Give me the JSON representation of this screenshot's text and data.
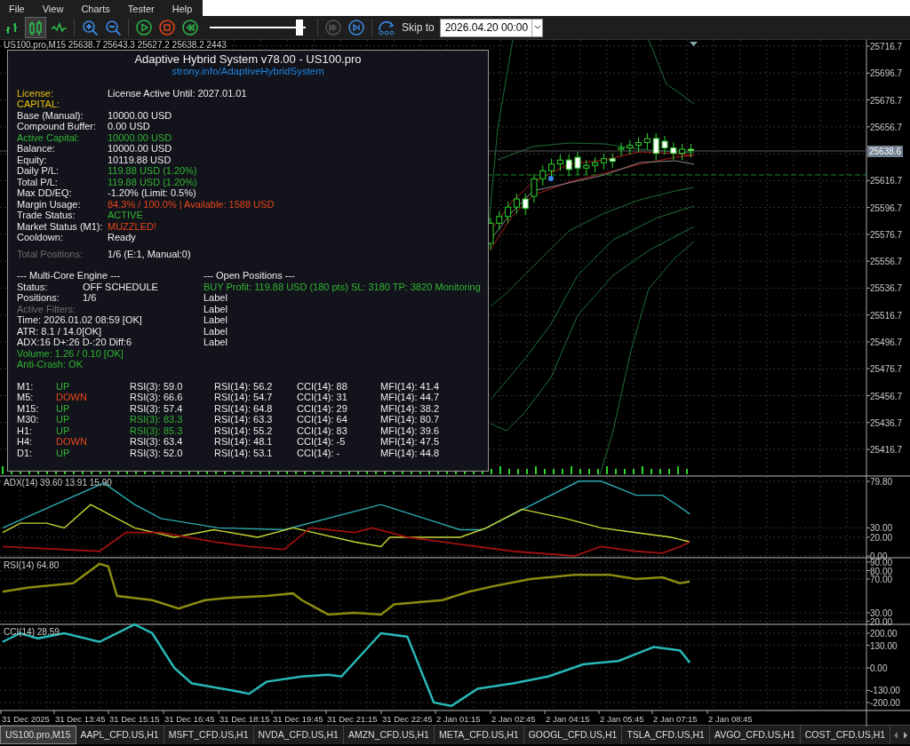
{
  "menu": [
    "File",
    "View",
    "Charts",
    "Tester",
    "Help"
  ],
  "toolbar": {
    "chart_types": [
      {
        "kind": "bars",
        "selected": false
      },
      {
        "kind": "candles",
        "selected": true
      },
      {
        "kind": "line",
        "selected": false
      }
    ],
    "playback": [
      {
        "kind": "play",
        "disabled": false
      },
      {
        "kind": "stop",
        "disabled": false
      },
      {
        "kind": "rewind",
        "disabled": false
      }
    ],
    "speed_slider": {
      "level": 0.97
    },
    "step_buttons": [
      {
        "kind": "fast_forward",
        "disabled": true
      },
      {
        "kind": "step",
        "disabled": false
      }
    ],
    "skip_label": "Skip to",
    "skip_date": "2026.04.20 00:00"
  },
  "chart": {
    "header": "US100.pro,M15  25638.7 25643.3 25627.2 25638.2  2443",
    "price_labels": [
      "25716.7",
      "25696.7",
      "25676.7",
      "25656.7",
      "25616.7",
      "25596.7",
      "25576.7",
      "25556.7",
      "25536.7",
      "25516.7",
      "25496.7",
      "25476.7",
      "25456.7",
      "25436.7",
      "25416.7"
    ],
    "current_price": "25638.6",
    "panes": [
      {
        "title": "ADX(14) 39.60 13.91 15.90",
        "labels": [
          "79.80",
          "30.00",
          "20.00",
          "0.00"
        ]
      },
      {
        "title": "RSI(14) 64.80",
        "labels": [
          "90.00",
          "80.00",
          "70.00",
          "30.00",
          "20.00"
        ]
      },
      {
        "title": "CCI(14) 28.59",
        "labels": [
          "200.00",
          "130.00",
          "0.00",
          "-130.00",
          "-200.00"
        ]
      }
    ],
    "time_labels": [
      "31 Dec 2025",
      "31 Dec 13:45",
      "31 Dec 15:15",
      "31 Dec 16:45",
      "31 Dec 18:15",
      "31 Dec 19:45",
      "31 Dec 21:15",
      "31 Dec 22:45",
      "2 Jan 01:15",
      "2 Jan 02:45",
      "2 Jan 04:15",
      "2 Jan 05:45",
      "2 Jan 07:15",
      "2 Jan 08:45"
    ]
  },
  "panel": {
    "title": "Adaptive Hybrid System v78.00 - US100.pro",
    "link": "strony.info/AdaptiveHybridSystem",
    "rows": [
      {
        "label": {
          "text": "License:",
          "color": "#e8c20a"
        },
        "value": {
          "text": "License Active Until: 2027.01.01",
          "color": "#eeeeee"
        }
      },
      {
        "label": {
          "text": "CAPITAL:",
          "color": "#e8c20a"
        }
      },
      {
        "label": {
          "text": "Base (Manual):",
          "color": "#eeeeee"
        },
        "value": {
          "text": "10000.00 USD",
          "color": "#eeeeee"
        }
      },
      {
        "label": {
          "text": "Compound Buffer:",
          "color": "#eeeeee"
        },
        "value": {
          "text": "0.00 USD",
          "color": "#eeeeee"
        }
      },
      {
        "label": {
          "text": "Active Capital:",
          "color": "#32b432"
        },
        "value": {
          "text": "10000.00 USD",
          "color": "#32b432"
        }
      },
      {
        "label": {
          "text": "Balance:",
          "color": "#eeeeee"
        },
        "value": {
          "text": "10000.00 USD",
          "color": "#eeeeee"
        }
      },
      {
        "label": {
          "text": "Equity:",
          "color": "#eeeeee"
        },
        "value": {
          "text": "10119.88 USD",
          "color": "#eeeeee"
        }
      },
      {
        "label": {
          "text": "Daily P/L:",
          "color": "#eeeeee"
        },
        "value": {
          "text": "119.88 USD (1.20%)",
          "color": "#32b432"
        }
      },
      {
        "label": {
          "text": "Total P/L:",
          "color": "#eeeeee"
        },
        "value": {
          "text": "119.88 USD (1.20%)",
          "color": "#32b432"
        }
      },
      {
        "label": {
          "text": "Max DD/EQ:",
          "color": "#eeeeee"
        },
        "value": {
          "text": "-1.20% (Limit: 0.5%)",
          "color": "#eeeeee"
        }
      },
      {
        "label": {
          "text": "Margin Usage:",
          "color": "#eeeeee"
        },
        "value": {
          "text": "84.3% / 100.0% | Available: 1588 USD",
          "color": "#e8461a"
        }
      },
      {
        "label": {
          "text": "Trade Status:",
          "color": "#eeeeee"
        },
        "value": {
          "text": "ACTIVE",
          "color": "#32b432"
        }
      },
      {
        "label": {
          "text": "Market Status (M1):",
          "color": "#eeeeee"
        },
        "value": {
          "text": "MUZZLED!",
          "color": "#e8461a"
        }
      },
      {
        "label": {
          "text": "Cooldown:",
          "color": "#eeeeee"
        },
        "value": {
          "text": "Ready",
          "color": "#eeeeee"
        }
      }
    ],
    "total_positions": {
      "label": {
        "text": "Total Positions:",
        "color": "#6e6e6e"
      },
      "value": {
        "text": "1/6 (E:1, Manual:0)",
        "color": "#eeeeee"
      }
    },
    "engine": {
      "title": "--- Multi-Core Engine ---",
      "rows": [
        {
          "label": {
            "text": "Status:",
            "color": "#eeeeee"
          },
          "value": {
            "text": "OFF SCHEDULE",
            "color": "#eeeeee"
          }
        },
        {
          "label": {
            "text": "Positions:",
            "color": "#eeeeee"
          },
          "value": {
            "text": "1/6",
            "color": "#eeeeee"
          }
        }
      ],
      "lines": [
        {
          "text": "Active Filters:",
          "color": "#6e6e6e"
        },
        {
          "text": "Time: 2026.01.02 08:59 [OK]",
          "color": "#eeeeee"
        },
        {
          "text": "ATR: 8.1 / 14.0[OK]",
          "color": "#eeeeee"
        },
        {
          "text": "ADX:16 D+:26 D-:20 Diff:6",
          "color": "#eeeeee"
        },
        {
          "text": "Volume: 1.26 / 0.10 [OK]",
          "color": "#32b432"
        },
        {
          "text": "Anti-Crash: OK",
          "color": "#32b432"
        }
      ]
    },
    "open_positions": {
      "title": "--- Open Positions ---",
      "lines": [
        {
          "text": "BUY Profit: 119.88 USD (180 pts) SL: 3180 TP: 3820 Monitoring",
          "color": "#32b432"
        },
        {
          "text": "Label",
          "color": "#eeeeee"
        },
        {
          "text": "Label",
          "color": "#eeeeee"
        },
        {
          "text": "Label",
          "color": "#eeeeee"
        },
        {
          "text": "Label",
          "color": "#eeeeee"
        },
        {
          "text": "Label",
          "color": "#eeeeee"
        }
      ]
    },
    "timeframes": [
      {
        "tf": "M1:",
        "trend": {
          "text": "UP",
          "color": "#32b432"
        },
        "rsi3": {
          "text": "RSI(3): 59.0",
          "color": "#eeeeee"
        },
        "rsi14": "RSI(14): 56.2",
        "cci": "CCI(14): 88",
        "mfi": "MFI(14): 41.4"
      },
      {
        "tf": "M5:",
        "trend": {
          "text": "DOWN",
          "color": "#e8461a"
        },
        "rsi3": {
          "text": "RSI(3): 66.6",
          "color": "#eeeeee"
        },
        "rsi14": "RSI(14): 54.7",
        "cci": "CCI(14): 31",
        "mfi": "MFI(14): 44.7"
      },
      {
        "tf": "M15:",
        "trend": {
          "text": "UP",
          "color": "#32b432"
        },
        "rsi3": {
          "text": "RSI(3): 57.4",
          "color": "#eeeeee"
        },
        "rsi14": "RSI(14): 64.8",
        "cci": "CCI(14): 29",
        "mfi": "MFI(14): 38.2"
      },
      {
        "tf": "M30:",
        "trend": {
          "text": "UP",
          "color": "#32b432"
        },
        "rsi3": {
          "text": "RSI(3): 83.3",
          "color": "#32b432"
        },
        "rsi14": "RSI(14): 63.3",
        "cci": "CCI(14): 64",
        "mfi": "MFI(14): 80.7"
      },
      {
        "tf": "H1:",
        "trend": {
          "text": "UP",
          "color": "#32b432"
        },
        "rsi3": {
          "text": "RSI(3): 85.3",
          "color": "#32b432"
        },
        "rsi14": "RSI(14): 55.2",
        "cci": "CCI(14): 83",
        "mfi": "MFI(14): 39.6"
      },
      {
        "tf": "H4:",
        "trend": {
          "text": "DOWN",
          "color": "#e8461a"
        },
        "rsi3": {
          "text": "RSI(3): 63.4",
          "color": "#eeeeee"
        },
        "rsi14": "RSI(14): 48.1",
        "cci": "CCI(14): -5",
        "mfi": "MFI(14): 47.5"
      },
      {
        "tf": "D1:",
        "trend": {
          "text": "UP",
          "color": "#32b432"
        },
        "rsi3": {
          "text": "RSI(3): 52.0",
          "color": "#eeeeee"
        },
        "rsi14": "RSI(14): 53.1",
        "cci": "CCI(14): -",
        "mfi": "MFI(14): 44.8"
      }
    ]
  },
  "tabs": [
    {
      "label": "US100.pro,M15",
      "selected": true
    },
    {
      "label": "AAPL_CFD.US,H1",
      "selected": false
    },
    {
      "label": "MSFT_CFD.US,H1",
      "selected": false
    },
    {
      "label": "NVDA_CFD.US,H1",
      "selected": false
    },
    {
      "label": "AMZN_CFD.US,H1",
      "selected": false
    },
    {
      "label": "META_CFD.US,H1",
      "selected": false
    },
    {
      "label": "GOOGL_CFD.US,H1",
      "selected": false
    },
    {
      "label": "TSLA_CFD.US,H1",
      "selected": false
    },
    {
      "label": "AVGO_CFD.US,H1",
      "selected": false
    },
    {
      "label": "COST_CFD.US,H1",
      "selected": false
    }
  ]
}
